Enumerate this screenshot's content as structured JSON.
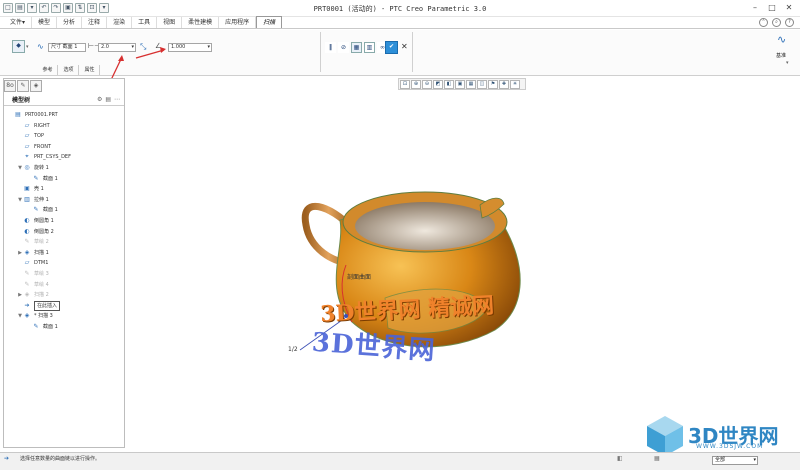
{
  "window": {
    "title": "PRT0001 (活动的) - PTC Creo Parametric 3.0",
    "controls": [
      "–",
      "□",
      "✕"
    ]
  },
  "quick_access": [
    "□",
    "▤",
    "▾",
    "↶",
    "↷",
    "▣",
    "⇅",
    "⊡",
    "▾"
  ],
  "menu_tabs": [
    "文件▾",
    "模型",
    "分析",
    "注释",
    "渲染",
    "工具",
    "视图",
    "柔性建模",
    "应用程序",
    "扫描"
  ],
  "ribbon": {
    "section_label_select": "尺寸",
    "section_label_depth": "截面 1",
    "thickness_value": "2.0",
    "offset_value": "1.000",
    "tabs": [
      "参考",
      "选项",
      "属性"
    ],
    "right_label": "基准"
  },
  "panel_tabs": [
    "8o",
    "✎",
    "◈"
  ],
  "tree": {
    "header": "模型树",
    "items": [
      {
        "label": "PRT0001.PRT",
        "icon": "▤",
        "exp": "",
        "dim": false,
        "indent": 0
      },
      {
        "label": "RIGHT",
        "icon": "▱",
        "exp": "",
        "dim": false,
        "indent": 1
      },
      {
        "label": "TOP",
        "icon": "▱",
        "exp": "",
        "dim": false,
        "indent": 1
      },
      {
        "label": "FRONT",
        "icon": "▱",
        "exp": "",
        "dim": false,
        "indent": 1
      },
      {
        "label": "PRT_CSYS_DEF",
        "icon": "⌖",
        "exp": "",
        "dim": false,
        "indent": 1
      },
      {
        "label": "旋转 1",
        "icon": "◎",
        "exp": "▼",
        "dim": false,
        "indent": 1
      },
      {
        "label": "截面 1",
        "icon": "✎",
        "exp": "",
        "dim": false,
        "indent": 2
      },
      {
        "label": "壳 1",
        "icon": "▣",
        "exp": "",
        "dim": false,
        "indent": 1
      },
      {
        "label": "拉伸 1",
        "icon": "▥",
        "exp": "▼",
        "dim": false,
        "indent": 1
      },
      {
        "label": "截面 1",
        "icon": "✎",
        "exp": "",
        "dim": false,
        "indent": 2
      },
      {
        "label": "倒圆角 1",
        "icon": "◐",
        "exp": "",
        "dim": false,
        "indent": 1
      },
      {
        "label": "倒圆角 2",
        "icon": "◐",
        "exp": "",
        "dim": false,
        "indent": 1
      },
      {
        "label": "草绘 2",
        "icon": "✎",
        "exp": "",
        "dim": true,
        "indent": 1
      },
      {
        "label": "扫描 1",
        "icon": "◈",
        "exp": "▶",
        "dim": false,
        "indent": 1
      },
      {
        "label": "DTM1",
        "icon": "▱",
        "exp": "",
        "dim": false,
        "indent": 1
      },
      {
        "label": "草绘 3",
        "icon": "✎",
        "exp": "",
        "dim": true,
        "indent": 1
      },
      {
        "label": "草绘 4",
        "icon": "✎",
        "exp": "",
        "dim": true,
        "indent": 1
      },
      {
        "label": "扫描 2",
        "icon": "◈",
        "exp": "▶",
        "dim": true,
        "indent": 1
      },
      {
        "label": "在此插入",
        "icon": "➔",
        "exp": "",
        "dim": false,
        "indent": 1,
        "insert": true
      },
      {
        "label": "* 扫描 3",
        "icon": "◈",
        "exp": "▼",
        "dim": false,
        "indent": 1
      },
      {
        "label": "截面 1",
        "icon": "✎",
        "exp": "",
        "dim": false,
        "indent": 2
      }
    ]
  },
  "canvas": {
    "dim_label": "剖面曲面",
    "dim_value": "1/2"
  },
  "status": {
    "message": "选择任意数量的曲面链以进行操作。",
    "filter": "全部"
  },
  "watermark": {
    "brand": "3D世界网",
    "url": "WWW.3DSJW.COM",
    "overlay_text": "3D世界网 精诚网"
  },
  "colors": {
    "accent": "#2d6fb7",
    "arrow": "#d73030",
    "part": "#d7871a",
    "inner": "#b8a38e"
  }
}
